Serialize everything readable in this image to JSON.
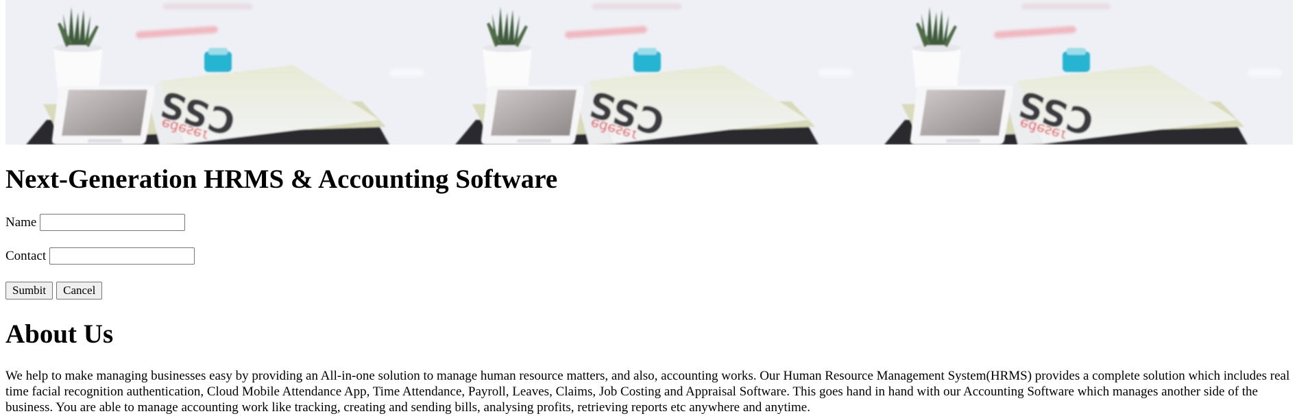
{
  "hero": {
    "image_subject": "desk scene with plant, phone and CSS book"
  },
  "header": {
    "title": "Next-Generation HRMS & Accounting Software"
  },
  "form": {
    "name_label": "Name",
    "name_value": "",
    "contact_label": "Contact",
    "contact_value": "",
    "submit_label": "Sumbit",
    "cancel_label": "Cancel"
  },
  "about": {
    "title": "About Us",
    "body": "We help to make managing businesses easy by providing an All-in-one solution to manage human resource matters, and also, accounting works. Our Human Resource Management System(HRMS) provides a complete solution which includes real time facial recognition authentication, Cloud Mobile Attendance App, Time Attendance, Payroll, Leaves, Claims, Job Costing and Appraisal Software. This goes hand in hand with our Accounting Software which manages another side of the business. You are able to manage accounting work like tracking, creating and sending bills, analysing profits, retrieving reports etc anywhere and anytime."
  },
  "colors": {
    "background": "#ffffff",
    "text": "#000000",
    "button_bg": "#efefef",
    "input_border": "#767676"
  }
}
